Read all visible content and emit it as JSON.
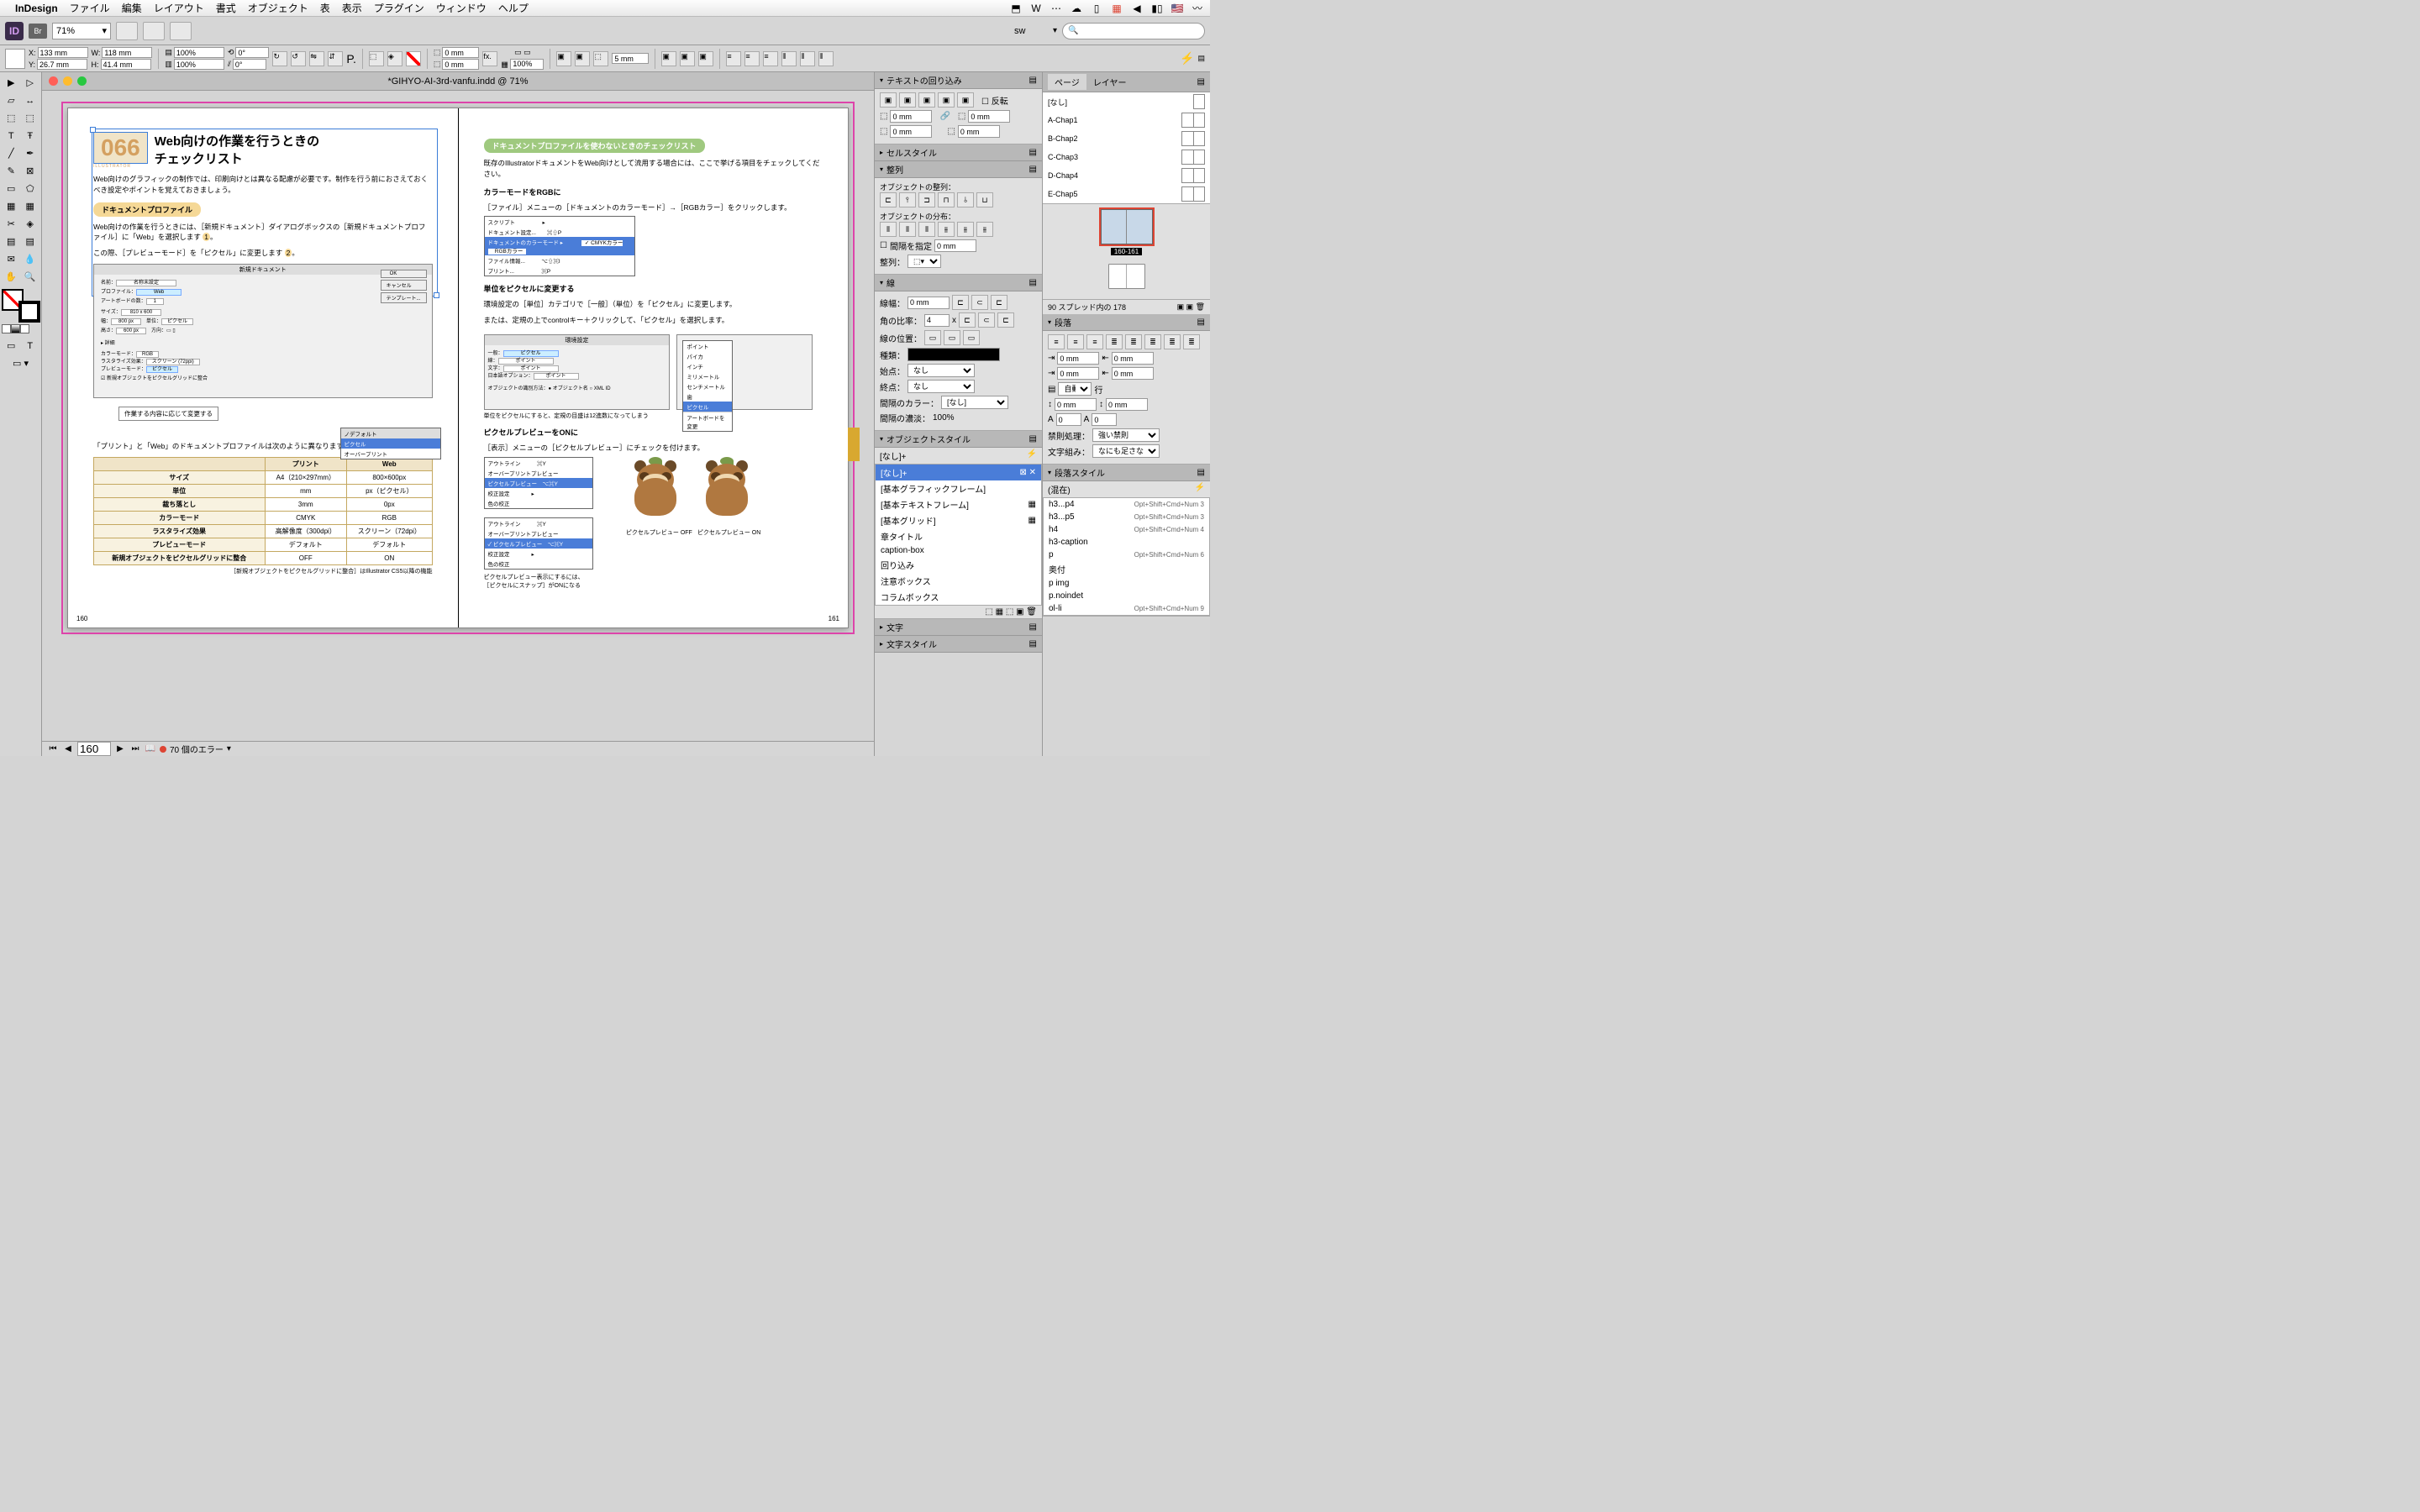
{
  "menubar": {
    "app": "InDesign",
    "items": [
      "ファイル",
      "編集",
      "レイアウト",
      "書式",
      "オブジェクト",
      "表",
      "表示",
      "プラグイン",
      "ウィンドウ",
      "ヘルプ"
    ]
  },
  "toolbar": {
    "br": "Br",
    "zoom": "71%",
    "workspace": "sw"
  },
  "control": {
    "x": "133 mm",
    "y": "26.7 mm",
    "w": "118 mm",
    "h": "41.4 mm",
    "scaleX": "100%",
    "scaleY": "100%",
    "rotate": "0°",
    "shear": "0°",
    "opacity": "100%",
    "stroke": "5 mm",
    "gap": "0 mm"
  },
  "document": {
    "title": "*GIHYO-AI-3rd-vanfu.indd @ 71%",
    "pageInput": "160",
    "errors": "70 個のエラー"
  },
  "leftPage": {
    "num": "066",
    "numSub": "ILLUSTRATOR",
    "title1": "Web向けの作業を行うときの",
    "title2": "チェックリスト",
    "intro": "Web向けのグラフィックの制作では、印刷向けとは異なる配慮が必要です。制作を行う前におさえておくべき設定やポイントを覚えておきましょう。",
    "h1": "ドキュメントプロファイル",
    "p1a": "Web向けの作業を行うときには、［新規ドキュメント］ダイアログボックスの［新規ドキュメントプロファイル］に「Web」を選択します",
    "p1b": "この際、［プレビューモード］を「ピクセル」に変更します",
    "callout": "作業する内容に応じて変更する",
    "tableIntro": "「プリント」と「Web」のドキュメントプロファイルは次のように異なります。",
    "tableFootnote": "［新規オブジェクトをピクセルグリッドに整合］はIllustrator CS5以降の機能",
    "pageNum": "160",
    "table": {
      "headers": [
        "",
        "プリント",
        "Web"
      ],
      "rows": [
        [
          "サイズ",
          "A4（210×297mm）",
          "800×600px"
        ],
        [
          "単位",
          "mm",
          "px（ピクセル）"
        ],
        [
          "裁ち落とし",
          "3mm",
          "0px"
        ],
        [
          "カラーモード",
          "CMYK",
          "RGB"
        ],
        [
          "ラスタライズ効果",
          "高解像度（300dpi）",
          "スクリーン（72dpi）"
        ],
        [
          "プレビューモード",
          "デフォルト",
          "デフォルト"
        ],
        [
          "新規オブジェクトをピクセルグリッドに整合",
          "OFF",
          "ON"
        ]
      ]
    }
  },
  "rightPage": {
    "h1": "ドキュメントプロファイルを使わないときのチェックリスト",
    "p1": "既存のIllustratorドキュメントをWeb向けとして流用する場合には、ここで挙げる項目をチェックしてください。",
    "h2": "カラーモードをRGBに",
    "p2": "［ファイル］メニューの［ドキュメントのカラーモード］→［RGBカラー］をクリックします。",
    "h3": "単位をピクセルに変更する",
    "p3a": "環境設定の［単位］カテゴリで［一般］（単位）を「ピクセル」に変更します。",
    "p3b": "または、定規の上でcontrolキー＋クリックして、「ピクセル」を選択します。",
    "caption3": "単位をピクセルにすると、定規の目盛は12進数になってしまう",
    "h4": "ピクセルプレビューをONに",
    "p4": "［表示］メニューの［ピクセルプレビュー］にチェックを付けます。",
    "tanukiOff": "ピクセルプレビュー OFF",
    "tanukiOn": "ピクセルプレビュー ON",
    "caption4a": "ピクセルプレビュー表示にするには、",
    "caption4b": "［ピクセルにスナップ］がONになる",
    "pageNum": "161"
  },
  "panels": {
    "textWrap": {
      "title": "テキストの回り込み",
      "invert": "反転",
      "offset": "0 mm"
    },
    "cellStyle": {
      "title": "セルスタイル"
    },
    "align": {
      "title": "整列",
      "objAlign": "オブジェクトの整列：",
      "objDist": "オブジェクトの分布：",
      "spacing": "間隔を指定",
      "spacingVal": "0 mm",
      "alignTo": "整列："
    },
    "stroke": {
      "title": "線",
      "weight": "線幅：",
      "weightVal": "0 mm",
      "corner": "角の比率：",
      "cornerVal": "4",
      "x": "x",
      "alignStroke": "線の位置：",
      "type": "種類：",
      "start": "始点：",
      "startVal": "なし",
      "end": "終点：",
      "endVal": "なし",
      "gapColor": "間隔のカラー：",
      "gapColorVal": "[なし]",
      "gapTint": "間隔の濃淡：",
      "gapTintVal": "100%"
    },
    "objStyle": {
      "title": "オブジェクトスタイル",
      "current": "[なし]+",
      "items": [
        "[なし]+",
        "[基本グラフィックフレーム]",
        "[基本テキストフレーム]",
        "[基本グリッド]",
        "章タイトル",
        "caption-box",
        "回り込み",
        "注意ボックス",
        "コラムボックス"
      ]
    },
    "char": {
      "title": "文字"
    },
    "charStyle": {
      "title": "文字スタイル"
    },
    "pages": {
      "tab1": "ページ",
      "tab2": "レイヤー",
      "masters": [
        "[なし]",
        "A-Chap1",
        "B-Chap2",
        "C-Chap3",
        "D-Chap4",
        "E-Chap5"
      ],
      "current": "160-161",
      "footer": "90 スプレッド内の 178"
    },
    "para": {
      "title": "段落",
      "leftIndent": "0 mm",
      "rightIndent": "0 mm",
      "firstLine": "0 mm",
      "lastLine": "0 mm",
      "auto": "自動",
      "lines": "行",
      "spaceBefore": "0 mm",
      "spaceAfter": "0 mm",
      "dropcap": "0",
      "dropcapChars": "0",
      "kinsoku": "禁則処理：",
      "kinsokuVal": "強い禁則",
      "mojikumi": "文字組み：",
      "mojikumiVal": "なにも足さない。なに..."
    },
    "paraStyle": {
      "title": "段落スタイル",
      "current": "(混在)",
      "items": [
        {
          "name": "h3...p4",
          "key": "Opt+Shift+Cmd+Num 3"
        },
        {
          "name": "h3...p5",
          "key": "Opt+Shift+Cmd+Num 3"
        },
        {
          "name": "h4",
          "key": "Opt+Shift+Cmd+Num 4"
        },
        {
          "name": "h3-caption",
          "key": ""
        },
        {
          "name": "p",
          "key": "Opt+Shift+Cmd+Num 6"
        },
        {
          "name": "奥付",
          "key": ""
        },
        {
          "name": "p img",
          "key": ""
        },
        {
          "name": "p.noindet",
          "key": ""
        },
        {
          "name": "ol-li",
          "key": "Opt+Shift+Cmd+Num 9"
        }
      ]
    }
  }
}
